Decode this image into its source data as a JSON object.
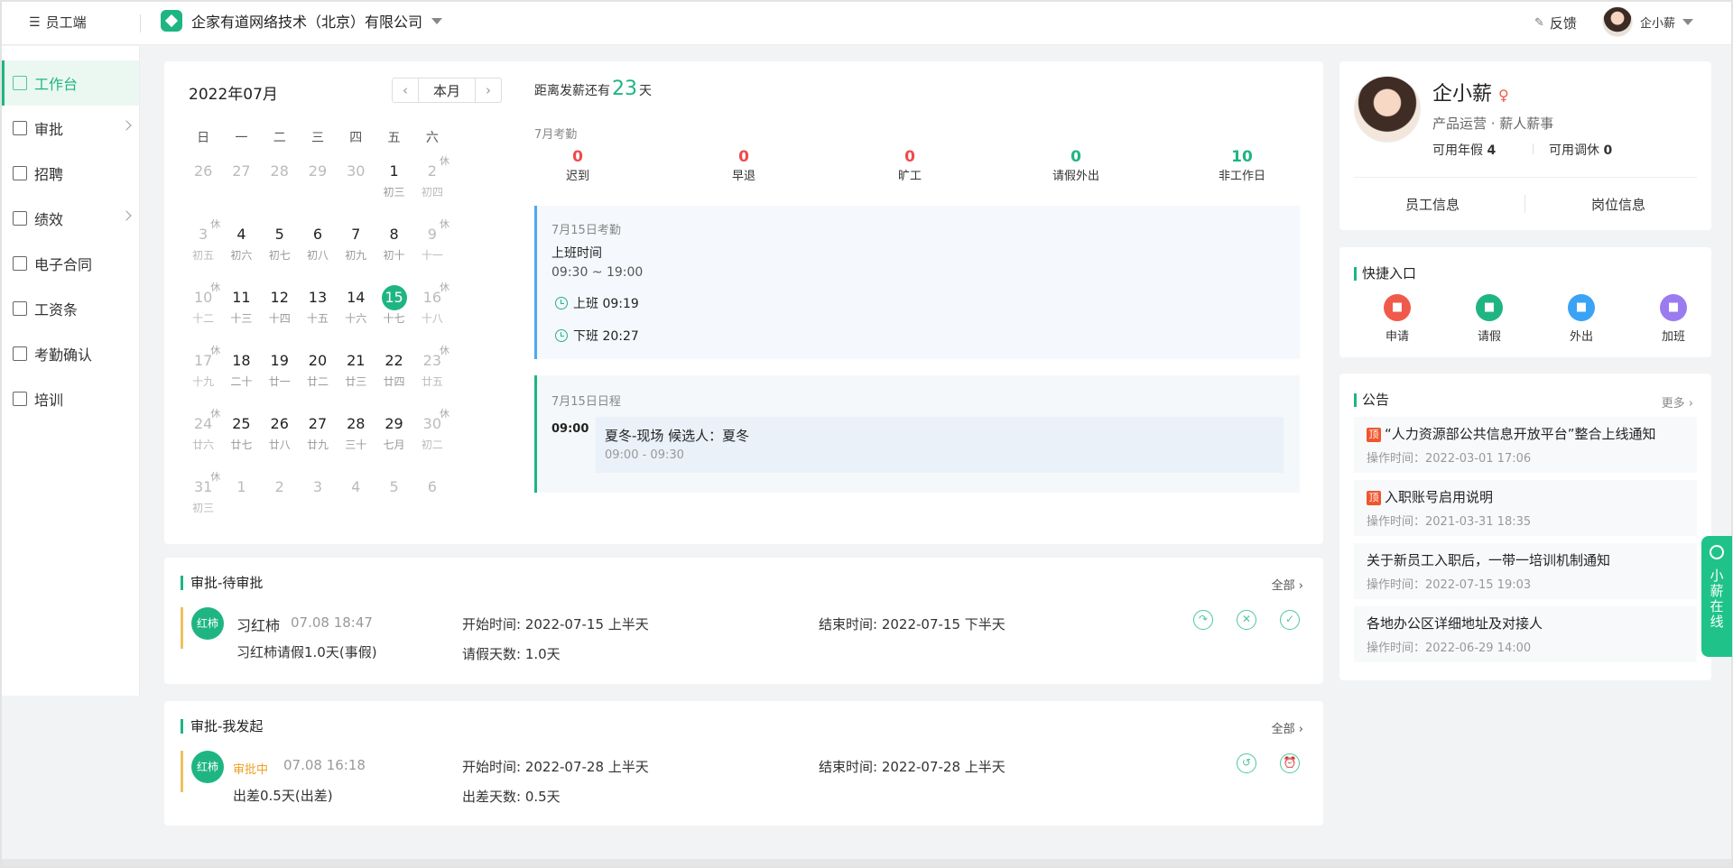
{
  "topbar": {
    "mode_label": "员工端",
    "company": "企家有道网络技术（北京）有限公司",
    "feedback": "反馈",
    "user_name": "企小薪"
  },
  "sidebar": {
    "items": [
      {
        "label": "工作台",
        "icon": "monitor-icon",
        "active": true
      },
      {
        "label": "审批",
        "icon": "stamp-icon",
        "has_submenu": true
      },
      {
        "label": "招聘",
        "icon": "scan-user-icon"
      },
      {
        "label": "绩效",
        "icon": "bar-chart-icon",
        "has_submenu": true
      },
      {
        "label": "电子合同",
        "icon": "contract-icon"
      },
      {
        "label": "工资条",
        "icon": "salary-icon"
      },
      {
        "label": "考勤确认",
        "icon": "calendar-check-icon"
      },
      {
        "label": "培训",
        "icon": "book-icon"
      }
    ]
  },
  "calendar": {
    "month_label": "2022年07月",
    "this_month_button": "本月",
    "weekdays": [
      "日",
      "一",
      "二",
      "三",
      "四",
      "五",
      "六"
    ],
    "weeks": [
      [
        {
          "d": "26",
          "l": "",
          "m": true
        },
        {
          "d": "27",
          "l": "",
          "m": true
        },
        {
          "d": "28",
          "l": "",
          "m": true
        },
        {
          "d": "29",
          "l": "",
          "m": true
        },
        {
          "d": "30",
          "l": "",
          "m": true
        },
        {
          "d": "1",
          "l": "初三"
        },
        {
          "d": "2",
          "l": "初四",
          "rest": "休",
          "m": true
        }
      ],
      [
        {
          "d": "3",
          "l": "初五",
          "rest": "休",
          "m": true
        },
        {
          "d": "4",
          "l": "初六"
        },
        {
          "d": "5",
          "l": "初七"
        },
        {
          "d": "6",
          "l": "初八"
        },
        {
          "d": "7",
          "l": "初九"
        },
        {
          "d": "8",
          "l": "初十"
        },
        {
          "d": "9",
          "l": "十一",
          "rest": "休",
          "m": true
        }
      ],
      [
        {
          "d": "10",
          "l": "十二",
          "rest": "休",
          "m": true
        },
        {
          "d": "11",
          "l": "十三"
        },
        {
          "d": "12",
          "l": "十四"
        },
        {
          "d": "13",
          "l": "十五"
        },
        {
          "d": "14",
          "l": "十六"
        },
        {
          "d": "15",
          "l": "十七",
          "today": true
        },
        {
          "d": "16",
          "l": "十八",
          "rest": "休",
          "m": true
        }
      ],
      [
        {
          "d": "17",
          "l": "十九",
          "rest": "休",
          "m": true
        },
        {
          "d": "18",
          "l": "二十"
        },
        {
          "d": "19",
          "l": "廿一"
        },
        {
          "d": "20",
          "l": "廿二"
        },
        {
          "d": "21",
          "l": "廿三"
        },
        {
          "d": "22",
          "l": "廿四"
        },
        {
          "d": "23",
          "l": "廿五",
          "rest": "休",
          "m": true
        }
      ],
      [
        {
          "d": "24",
          "l": "廿六",
          "rest": "休",
          "m": true
        },
        {
          "d": "25",
          "l": "廿七"
        },
        {
          "d": "26",
          "l": "廿八"
        },
        {
          "d": "27",
          "l": "廿九"
        },
        {
          "d": "28",
          "l": "三十"
        },
        {
          "d": "29",
          "l": "七月"
        },
        {
          "d": "30",
          "l": "初二",
          "rest": "休",
          "m": true
        }
      ],
      [
        {
          "d": "31",
          "l": "初三",
          "rest": "休",
          "m": true
        },
        {
          "d": "1",
          "l": "",
          "m": true
        },
        {
          "d": "2",
          "l": "",
          "m": true
        },
        {
          "d": "3",
          "l": "",
          "m": true
        },
        {
          "d": "4",
          "l": "",
          "m": true
        },
        {
          "d": "5",
          "l": "",
          "m": true
        },
        {
          "d": "6",
          "l": "",
          "m": true
        }
      ]
    ]
  },
  "payday": {
    "prefix": "距离发薪还有",
    "days": "23",
    "suffix": "天"
  },
  "attendance": {
    "title": "7月考勤",
    "stats": [
      {
        "value": "0",
        "label": "迟到"
      },
      {
        "value": "0",
        "label": "早退"
      },
      {
        "value": "0",
        "label": "旷工"
      },
      {
        "value": "0",
        "label": "请假外出"
      },
      {
        "value": "10",
        "label": "非工作日"
      }
    ],
    "day_title": "7月15日考勤",
    "work_time_label": "上班时间",
    "work_time": "09:30 ~ 19:00",
    "clock_in": "上班 09:19",
    "clock_out": "下班 20:27"
  },
  "schedule": {
    "title": "7月15日日程",
    "time": "09:00",
    "event_title": "夏冬-现场 候选人：夏冬",
    "event_time": "09:00 - 09:30"
  },
  "pending": {
    "title": "审批-待审批",
    "all_link": "全部",
    "avatar_text": "红柿",
    "name": "习红柿",
    "time": "07.08 18:47",
    "desc": "习红柿请假1.0天(事假)",
    "start": "开始时间: 2022-07-15 上半天",
    "end": "结束时间: 2022-07-15 下半天",
    "days": "请假天数: 1.0天"
  },
  "initiated": {
    "title": "审批-我发起",
    "all_link": "全部",
    "avatar_text": "红柿",
    "status": "审批中",
    "time": "07.08 16:18",
    "desc": "出差0.5天(出差)",
    "start": "开始时间: 2022-07-28 上半天",
    "end": "结束时间: 2022-07-28 上半天",
    "days": "出差天数: 0.5天"
  },
  "profile": {
    "name": "企小薪",
    "dept": "产品运营 · 薪人薪事",
    "annual_leave_label": "可用年假",
    "annual_leave": "4",
    "comp_leave_label": "可用调休",
    "comp_leave": "0",
    "tab_employee": "员工信息",
    "tab_position": "岗位信息"
  },
  "quick": {
    "title": "快捷入口",
    "items": [
      {
        "label": "申请",
        "color": "#f05a4a",
        "icon": "doc-icon"
      },
      {
        "label": "请假",
        "color": "#1fb583",
        "icon": "calendar-icon"
      },
      {
        "label": "外出",
        "color": "#3aa3f5",
        "icon": "luggage-icon"
      },
      {
        "label": "加班",
        "color": "#9b7bf0",
        "icon": "clock-icon"
      }
    ]
  },
  "notice": {
    "title": "公告",
    "more": "更多",
    "top_tag": "顶",
    "items": [
      {
        "title": "“人力资源部公共信息开放平台”整合上线通知",
        "meta": "操作时间：2022-03-01 17:06",
        "top": true
      },
      {
        "title": "入职账号启用说明",
        "meta": "操作时间：2021-03-31 18:35",
        "top": true
      },
      {
        "title": "关于新员工入职后，一带一培训机制通知",
        "meta": "操作时间：2022-07-15 19:03",
        "top": false
      },
      {
        "title": "各地办公区详细地址及对接人",
        "meta": "操作时间：2022-06-29 14:00",
        "top": false
      }
    ]
  },
  "help": {
    "label": "小薪在线"
  }
}
